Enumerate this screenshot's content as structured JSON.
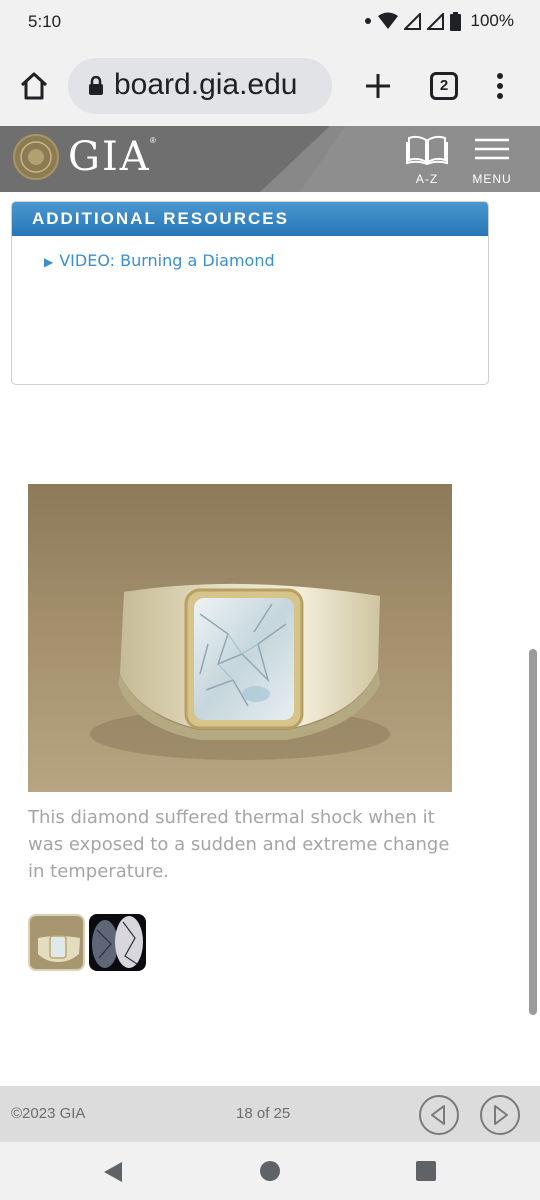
{
  "status_bar": {
    "time": "5:10",
    "battery": "100%",
    "icons": [
      "notification-dot-icon",
      "wifi-icon",
      "signal-icon",
      "signal-icon",
      "battery-icon"
    ]
  },
  "browser": {
    "url": "board.gia.edu",
    "tab_count": "2",
    "icons": [
      "home-icon",
      "lock-icon",
      "plus-icon",
      "more-vert-icon"
    ]
  },
  "site_header": {
    "logo_text": "GIA",
    "registered_mark": "®",
    "az_label": "A-Z",
    "menu_label": "MENU",
    "icons": [
      "gia-seal-logo",
      "book-icon",
      "hamburger-icon"
    ]
  },
  "resources": {
    "title": "ADDITIONAL RESOURCES",
    "links": [
      {
        "label": "VIDEO: Burning a Diamond",
        "icon": "play-triangle-icon"
      }
    ]
  },
  "slide": {
    "image_alt": "diamond ring in gold bezel setting with fractured white diamond",
    "caption": "This diamond suffered thermal shock when it was exposed to a sudden and extreme change in temperature.",
    "thumbnails": [
      "ring-thumbnail",
      "diamond-closeup-thumbnail"
    ]
  },
  "footer": {
    "copyright": "©2023 GIA",
    "page_count": "18 of 25",
    "icons": [
      "previous-arrow-icon",
      "next-arrow-icon"
    ]
  },
  "navbar": {
    "icons": [
      "back-triangle-icon",
      "home-circle-icon",
      "recents-square-icon"
    ]
  },
  "colors": {
    "resources_header": "#2e7fbf",
    "link": "#3a8fd0",
    "caption": "#a5a5a5",
    "header_gray": "#7f7f7f"
  }
}
